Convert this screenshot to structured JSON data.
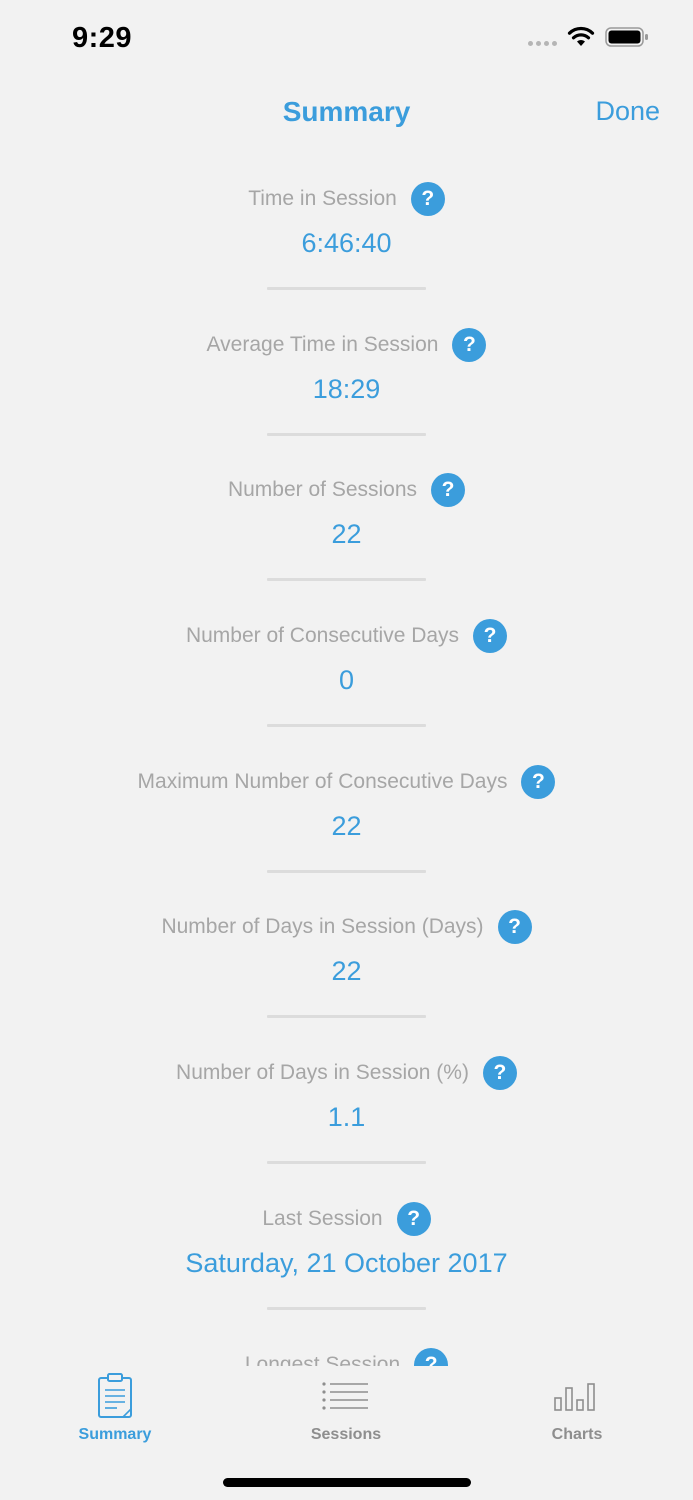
{
  "status_bar": {
    "time": "9:29"
  },
  "nav": {
    "title": "Summary",
    "done_label": "Done"
  },
  "stats": [
    {
      "label": "Time in Session",
      "value": "6:46:40"
    },
    {
      "label": "Average Time in Session",
      "value": "18:29"
    },
    {
      "label": "Number of Sessions",
      "value": "22"
    },
    {
      "label": "Number of Consecutive Days",
      "value": "0"
    },
    {
      "label": "Maximum Number of Consecutive Days",
      "value": "22"
    },
    {
      "label": "Number of Days in Session (Days)",
      "value": "22"
    },
    {
      "label": "Number of Days in Session (%)",
      "value": "1.1"
    },
    {
      "label": "Last Session",
      "value": "Saturday, 21 October 2017"
    },
    {
      "label": "Longest Session",
      "value": ""
    }
  ],
  "help_glyph": "?",
  "tabs": [
    {
      "label": "Summary",
      "icon": "clipboard-icon",
      "active": true
    },
    {
      "label": "Sessions",
      "icon": "list-icon",
      "active": false
    },
    {
      "label": "Charts",
      "icon": "bar-chart-icon",
      "active": false
    }
  ],
  "colors": {
    "accent": "#3b9ddc",
    "label_gray": "#a6a6a6",
    "background": "#f2f2f2",
    "inactive_tab": "#8e8e8e"
  }
}
